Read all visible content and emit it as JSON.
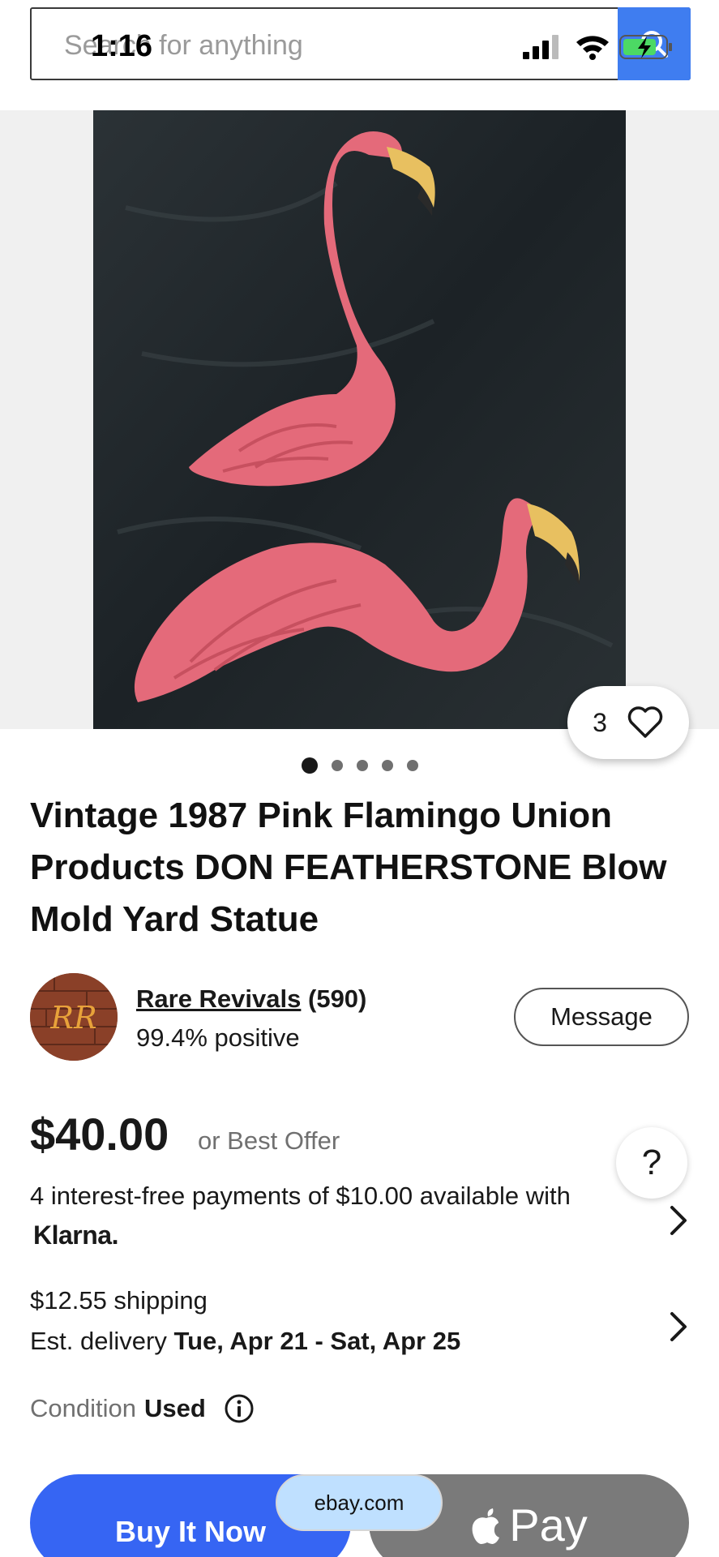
{
  "status_bar": {
    "time": "1:16"
  },
  "search": {
    "placeholder": "Search for anything"
  },
  "listing": {
    "watch_count": "3",
    "image_count": 5,
    "active_image": 1,
    "title": "Vintage 1987 Pink Flamingo Union Products DON FEATHERSTONE Blow Mold Yard Statue"
  },
  "seller": {
    "name": "Rare Revivals",
    "score": "(590)",
    "feedback": "99.4% positive",
    "message_label": "Message"
  },
  "price": {
    "amount": "$40.00",
    "best_offer": "or Best Offer",
    "help_label": "?"
  },
  "klarna": {
    "text": "4 interest-free payments of $10.00 available with",
    "logo": "Klarna."
  },
  "shipping": {
    "cost": "$12.55 shipping",
    "delivery_prefix": "Est. delivery",
    "delivery_range": "Tue, Apr 21 - Sat, Apr 25"
  },
  "condition": {
    "label": "Condition",
    "value": "Used"
  },
  "actions": {
    "buy_now": "Buy It Now",
    "apple_pay": "Pay",
    "url": "ebay.com"
  },
  "colors": {
    "accent": "#3665f3",
    "search_button": "#3f7df0",
    "apple_pay": "#7a7a7a"
  }
}
